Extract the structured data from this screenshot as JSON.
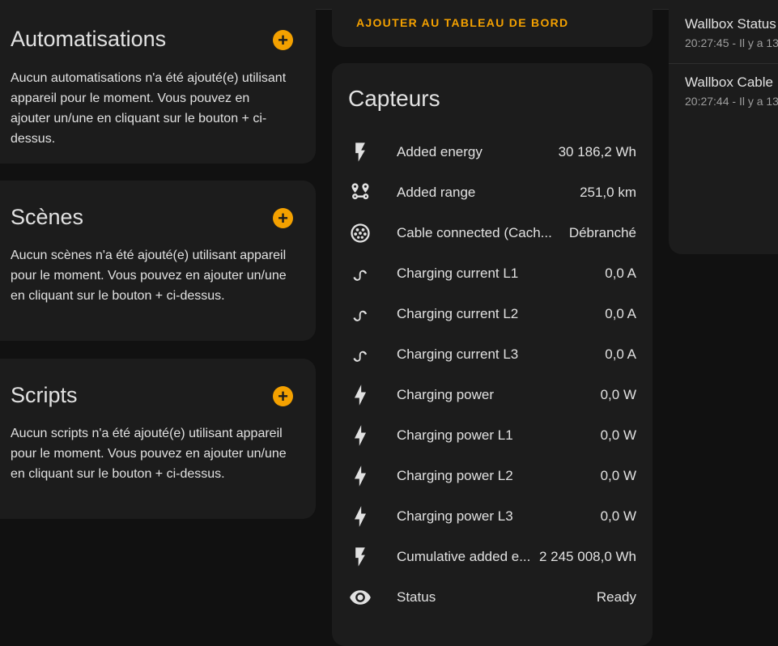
{
  "automations": {
    "title": "Automatisations",
    "add_label": "+",
    "description": "Aucun automatisations n'a été ajouté(e) utilisant appareil pour le moment. Vous pouvez en ajouter un/une en cliquant sur le bouton + ci-dessus."
  },
  "scenes": {
    "title": "Scènes",
    "add_label": "+",
    "description": "Aucun scènes n'a été ajouté(e) utilisant appareil pour le moment. Vous pouvez en ajouter un/une en cliquant sur le bouton + ci-dessus."
  },
  "scripts": {
    "title": "Scripts",
    "add_label": "+",
    "description": "Aucun scripts n'a été ajouté(e) utilisant appareil pour le moment. Vous pouvez en ajouter un/une en cliquant sur le bouton + ci-dessus."
  },
  "dashboard_action": {
    "label": "AJOUTER AU TABLEAU DE BORD"
  },
  "sensors": {
    "title": "Capteurs",
    "rows": [
      {
        "icon": "flash-icon",
        "name": "Added energy",
        "value": "30 186,2 Wh"
      },
      {
        "icon": "map-marker-distance-icon",
        "name": "Added range",
        "value": "251,0 km"
      },
      {
        "icon": "ev-plug-icon",
        "name": "Cable connected (Cach...",
        "value": "Débranché"
      },
      {
        "icon": "current-ac-icon",
        "name": "Charging current L1",
        "value": "0,0 A"
      },
      {
        "icon": "current-ac-icon",
        "name": "Charging current L2",
        "value": "0,0 A"
      },
      {
        "icon": "current-ac-icon",
        "name": "Charging current L3",
        "value": "0,0 A"
      },
      {
        "icon": "lightning-bolt-icon",
        "name": "Charging power",
        "value": "0,0 W"
      },
      {
        "icon": "lightning-bolt-icon",
        "name": "Charging power L1",
        "value": "0,0 W"
      },
      {
        "icon": "lightning-bolt-icon",
        "name": "Charging power L2",
        "value": "0,0 W"
      },
      {
        "icon": "lightning-bolt-icon",
        "name": "Charging power L3",
        "value": "0,0 W"
      },
      {
        "icon": "flash-icon",
        "name": "Cumulative added e...",
        "value": "2 245 008,0 Wh"
      },
      {
        "icon": "eye-icon",
        "name": "Status",
        "value": "Ready"
      }
    ]
  },
  "logbook": {
    "entries": [
      {
        "entity": "Wallbox Status",
        "time": "20:27:45 - Il y a 13"
      },
      {
        "entity": "Wallbox Cable",
        "time": "20:27:44 - Il y a 13"
      }
    ]
  }
}
